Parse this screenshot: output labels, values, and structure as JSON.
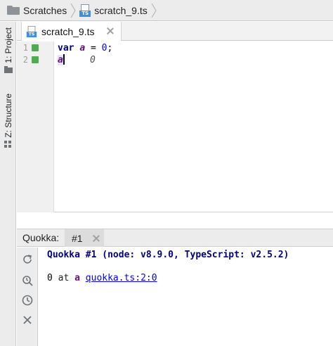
{
  "breadcrumb": {
    "items": [
      {
        "label": "Scratches",
        "icon": "folder-icon"
      },
      {
        "label": "scratch_9.ts",
        "icon": "typescript-file-icon"
      }
    ]
  },
  "left_strip": {
    "project_label": "1: Project",
    "structure_label": "Z: Structure"
  },
  "editor": {
    "tab": {
      "label": "scratch_9.ts",
      "icon_badge": "TS"
    },
    "lines": [
      {
        "number": "1",
        "keyword": "var",
        "var_name": "a",
        "rest": " = ",
        "value": "0",
        "end": ";"
      },
      {
        "number": "2",
        "ident": "a",
        "inline_value": "0"
      }
    ]
  },
  "quokka": {
    "title": "Quokka:",
    "tab_label": "#1",
    "header_line": "Quokka #1 (node: v8.9.0, TypeScript: v2.5.2)",
    "output": {
      "value": "0",
      "at_text": " at ",
      "var_name": "a",
      "location": "quokka.ts:2:0"
    },
    "toolbar_icons": [
      "refresh-icon",
      "coverage-icon",
      "history-icon",
      "close-icon"
    ]
  },
  "colors": {
    "keyword": "#000080",
    "variable": "#660e7a",
    "number": "#0000ff",
    "run_marker": "#4cae4c",
    "ts_badge": "#3e8ee6"
  }
}
